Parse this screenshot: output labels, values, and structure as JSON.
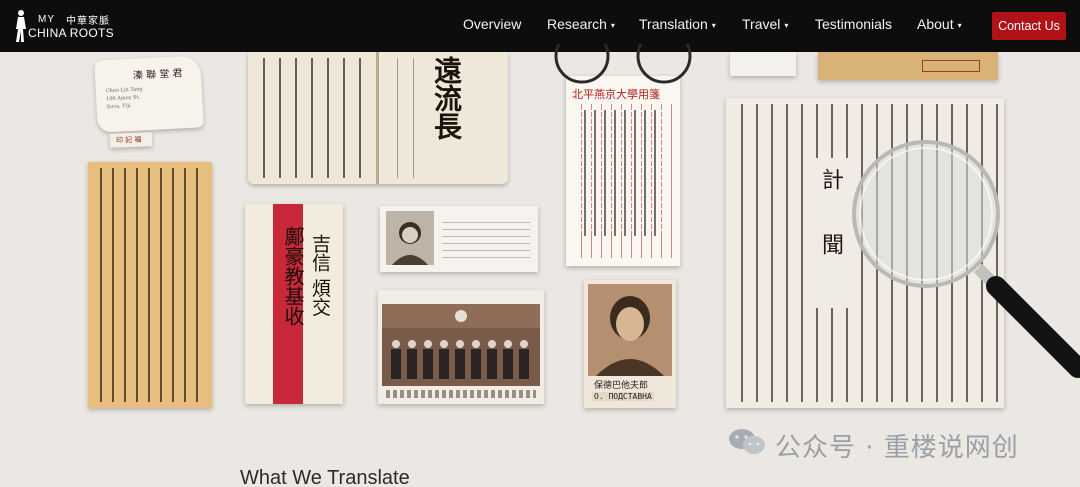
{
  "brand": {
    "line1": "MY",
    "han": "中華家脈",
    "line2": "CHINA ROOTS"
  },
  "nav": {
    "items": [
      {
        "label": "Overview",
        "dropdown": false
      },
      {
        "label": "Research",
        "dropdown": true
      },
      {
        "label": "Translation",
        "dropdown": true
      },
      {
        "label": "Travel",
        "dropdown": true
      },
      {
        "label": "Testimonials",
        "dropdown": false
      },
      {
        "label": "About",
        "dropdown": true
      }
    ],
    "caret": "▾",
    "contact_label": "Contact Us"
  },
  "documents": {
    "envelope_name": "溱 聯 堂 君",
    "envelope_lines": [
      "Chen Lin Tang",
      "106 Amoy St.",
      "Suva, Fiji"
    ],
    "stamp_text": "印 記 福",
    "book_title": "遠流長",
    "red_strip_text": "鄺豪教基收",
    "side_text": "吉信 煩交",
    "letterhead": "北平燕京大學用箋",
    "obituary_title": "計 聞",
    "portrait_caption": "О. ПОДСТАВНА",
    "portrait_caption_cn": "保德巴他夫郎"
  },
  "section": {
    "heading": "What We Translate"
  },
  "watermark": {
    "text": "公众号 · 重楼说网创"
  },
  "colors": {
    "nav_bg": "#0d0d0d",
    "page_bg": "#ebe8e4",
    "contact_bg": "#b01218"
  }
}
